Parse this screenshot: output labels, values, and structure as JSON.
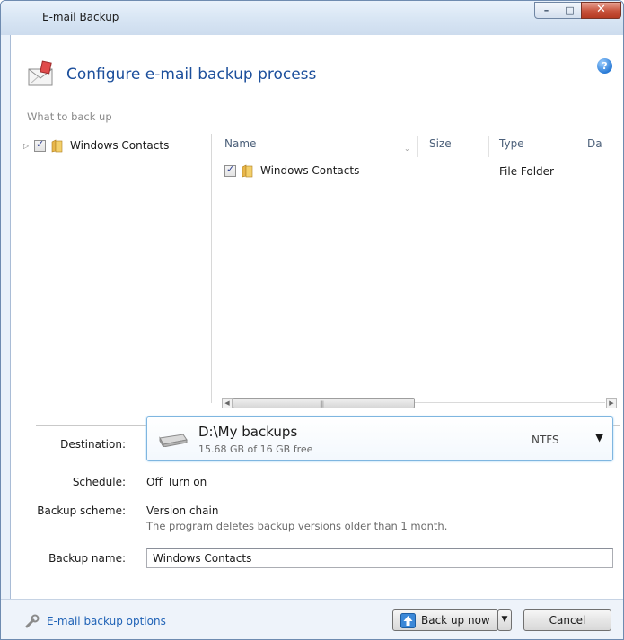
{
  "window": {
    "title": "E-mail Backup",
    "minimize_glyph": "–",
    "maximize_glyph": "□",
    "close_glyph": "✕"
  },
  "header": {
    "title": "Configure e-mail backup process",
    "help_glyph": "?"
  },
  "what_to_back_up": {
    "section_label": "What to back up",
    "tree": [
      {
        "label": "Windows Contacts",
        "checked": true,
        "expander": "▷"
      }
    ],
    "list": {
      "columns": [
        "Name",
        "Size",
        "Type",
        "Da"
      ],
      "rows": [
        {
          "name": "Windows Contacts",
          "size": "",
          "type": "File Folder",
          "checked": true
        }
      ]
    }
  },
  "form": {
    "destination_label": "Destination:",
    "destination_path": "D:\\My backups",
    "destination_free": "15.68 GB of 16 GB free",
    "destination_fs": "NTFS",
    "schedule_label": "Schedule:",
    "schedule_value": "Off",
    "schedule_link": "Turn on",
    "scheme_label": "Backup scheme:",
    "scheme_link": "Version chain",
    "scheme_desc": "The program deletes backup versions older than 1 month.",
    "name_label": "Backup name:",
    "name_value": "Windows Contacts"
  },
  "footer": {
    "options_link": "E-mail backup options",
    "backup_now": "Back up now",
    "cancel": "Cancel"
  },
  "colors": {
    "accent_title": "#1c4f9c",
    "link": "#1f62b6",
    "close_button": "#c7523b"
  },
  "icons": [
    "email-backup-icon",
    "help-icon",
    "folder-icon",
    "hard-drive-icon",
    "wrench-icon",
    "backup-up-arrow-icon"
  ]
}
